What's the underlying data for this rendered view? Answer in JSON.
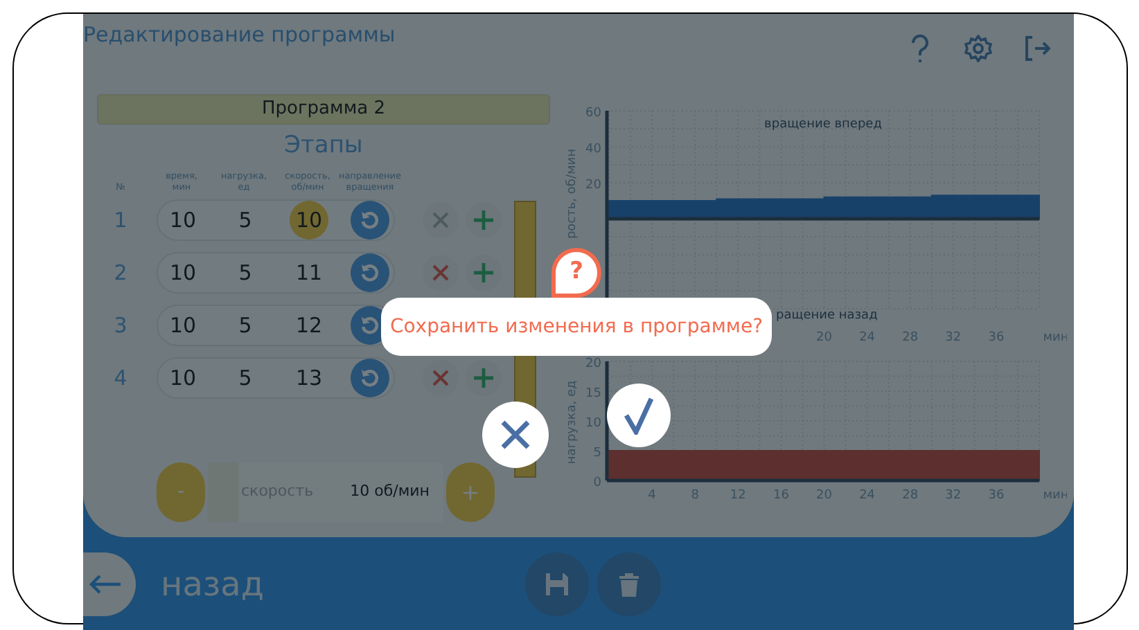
{
  "header": {
    "title": "Редактирование программы",
    "icons": [
      {
        "kind": "help"
      },
      {
        "kind": "settings"
      },
      {
        "kind": "logout"
      }
    ]
  },
  "program": {
    "name": "Программа 2"
  },
  "stages": {
    "title": "Этапы",
    "columns": [
      "№",
      "время, мин",
      "нагрузка, ед",
      "скорость, об/мин",
      "направление вращения"
    ],
    "rows": [
      {
        "number": "1",
        "time": "10",
        "load": "5",
        "speed": "10",
        "selected": true,
        "can_delete": false
      },
      {
        "number": "2",
        "time": "10",
        "load": "5",
        "speed": "11",
        "selected": false,
        "can_delete": true
      },
      {
        "number": "3",
        "time": "10",
        "load": "5",
        "speed": "12",
        "selected": false
      },
      {
        "number": "4",
        "time": "10",
        "load": "5",
        "speed": "13",
        "selected": false,
        "can_delete": true
      }
    ]
  },
  "speed_control": {
    "minus": "-",
    "label": "скорость",
    "value": "10 об/мин",
    "plus": "+",
    "level": 0.13
  },
  "speed_chart": {
    "chart_data": {
      "type": "area",
      "ylabel": "рость, об/мин",
      "xlabel": "мин",
      "annotations": [
        "вращение вперед",
        "ращение назад"
      ],
      "x": [
        0,
        10,
        10,
        20,
        20,
        30,
        30,
        40
      ],
      "series": [
        {
          "color": "#1565c0",
          "values": [
            10,
            10,
            11,
            11,
            12,
            12,
            13,
            13
          ]
        }
      ],
      "xlim": [
        0,
        40
      ],
      "ylim": [
        -50,
        60
      ],
      "xticks": [
        20,
        24,
        28,
        32,
        36
      ],
      "yticks": [
        20,
        40,
        60
      ],
      "grid": true
    }
  },
  "load_chart": {
    "chart_data": {
      "type": "area",
      "ylabel": "нагрузка, ед",
      "xlabel": "мин",
      "x": [
        0,
        40
      ],
      "series": [
        {
          "color": "#c0392b",
          "values": [
            5,
            5
          ]
        }
      ],
      "xlim": [
        0,
        40
      ],
      "ylim": [
        0,
        20
      ],
      "xticks": [
        4,
        8,
        12,
        16,
        20,
        24,
        28,
        32,
        36
      ],
      "yticks": [
        0,
        5,
        10,
        15,
        20
      ],
      "grid": true
    }
  },
  "footer": {
    "back_label": "назад"
  },
  "dialog": {
    "badge": "?",
    "message": "Сохранить изменения в программе?"
  }
}
